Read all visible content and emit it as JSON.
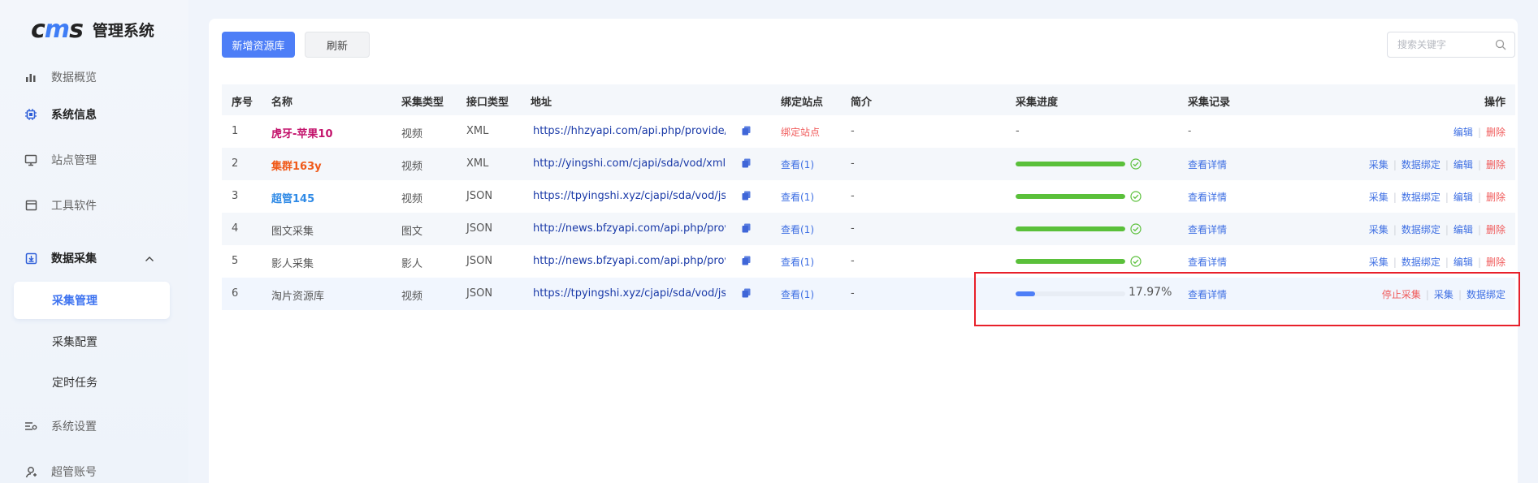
{
  "brand": {
    "mark_left": "c",
    "mark_mid": "m",
    "mark_right": "s",
    "title": "管理系统"
  },
  "sidebar": {
    "items": [
      {
        "label": "数据概览",
        "icon": "bar-chart-icon"
      },
      {
        "label": "系统信息",
        "icon": "chip-icon"
      },
      {
        "label": "站点管理",
        "icon": "monitor-icon"
      },
      {
        "label": "工具软件",
        "icon": "window-icon"
      },
      {
        "label": "数据采集",
        "icon": "collect-icon"
      }
    ],
    "subitems": [
      {
        "label": "采集管理"
      },
      {
        "label": "采集配置"
      },
      {
        "label": "定时任务"
      }
    ],
    "bottom": [
      {
        "label": "系统设置",
        "icon": "settings-icon"
      },
      {
        "label": "超管账号",
        "icon": "user-icon"
      }
    ]
  },
  "toolbar": {
    "add_label": "新增资源库",
    "refresh_label": "刷新",
    "search_placeholder": "搜索关键字"
  },
  "table": {
    "headers": {
      "idx": "序号",
      "name": "名称",
      "collect_type": "采集类型",
      "api_type": "接口类型",
      "url": "地址",
      "bind": "绑定站点",
      "desc": "简介",
      "progress": "采集进度",
      "record": "采集记录",
      "ops": "操作"
    },
    "rows": [
      {
        "idx": "1",
        "name": "虎牙-苹果10",
        "name_color": "#c3126b",
        "collect_type": "视频",
        "api_type": "XML",
        "url": "https://hhzyapi.com/api.php/provide/vod",
        "bind": "绑定站点",
        "desc": "-",
        "progress_text": "-",
        "record": "-",
        "ops": [
          "编辑",
          "删除"
        ]
      },
      {
        "idx": "2",
        "name": "集群163y",
        "name_color": "#f05a1a",
        "collect_type": "视频",
        "api_type": "XML",
        "url": "http://yingshi.com/cjapi/sda/vod/xml.html",
        "bind": "查看(1)",
        "desc": "-",
        "progress": 1.0,
        "record": "查看详情",
        "ops": [
          "采集",
          "数据绑定",
          "编辑",
          "删除"
        ]
      },
      {
        "idx": "3",
        "name": "超管145",
        "name_color": "#2f8ae6",
        "collect_type": "视频",
        "api_type": "JSON",
        "url": "https://tpyingshi.xyz/cjapi/sda/vod/json.html",
        "bind": "查看(1)",
        "desc": "-",
        "progress": 1.0,
        "record": "查看详情",
        "ops": [
          "采集",
          "数据绑定",
          "编辑",
          "删除"
        ]
      },
      {
        "idx": "4",
        "name": "图文采集",
        "name_color": "#555555",
        "collect_type": "图文",
        "api_type": "JSON",
        "url": "http://news.bfzyapi.com/api.php/provide/art",
        "bind": "查看(1)",
        "desc": "-",
        "progress": 1.0,
        "record": "查看详情",
        "ops": [
          "采集",
          "数据绑定",
          "编辑",
          "删除"
        ]
      },
      {
        "idx": "5",
        "name": "影人采集",
        "name_color": "#555555",
        "collect_type": "影人",
        "api_type": "JSON",
        "url": "http://news.bfzyapi.com/api.php/provide/actor",
        "bind": "查看(1)",
        "desc": "-",
        "progress": 1.0,
        "record": "查看详情",
        "ops": [
          "采集",
          "数据绑定",
          "编辑",
          "删除"
        ]
      },
      {
        "idx": "6",
        "name": "淘片资源库",
        "name_color": "#555555",
        "collect_type": "视频",
        "api_type": "JSON",
        "url": "https://tpyingshi.xyz/cjapi/sda/vod/json.html",
        "bind": "查看(1)",
        "desc": "-",
        "progress": 0.1797,
        "progress_text": "17.97%",
        "record": "查看详情",
        "ops": [
          "停止采集",
          "采集",
          "数据绑定"
        ]
      }
    ]
  },
  "colors": {
    "accent": "#4d7ef7",
    "done": "#5ac03a",
    "danger": "#f05a5a",
    "link": "#3e6fe3",
    "highlight_box": "#e8202a"
  }
}
